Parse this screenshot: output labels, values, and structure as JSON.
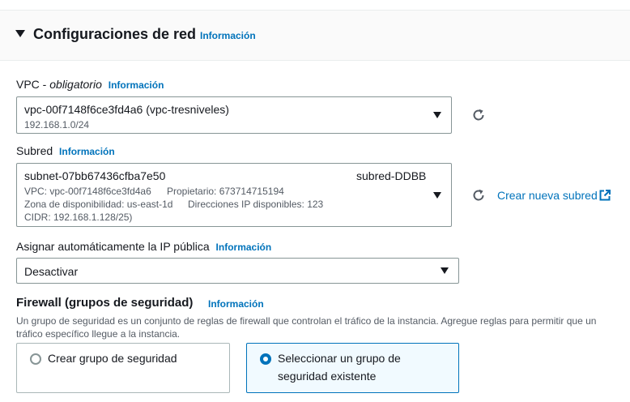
{
  "section": {
    "title": "Configuraciones de red",
    "info": "Información"
  },
  "vpc": {
    "label": "VPC",
    "label_sep": " - ",
    "label_required": "obligatorio",
    "info": "Información",
    "value": "vpc-00f7148f6ce3fd4a6 (vpc-tresniveles)",
    "cidr": "192.168.1.0/24"
  },
  "subnet": {
    "label": "Subred",
    "info": "Información",
    "value": "subnet-07bb67436cfba7e50",
    "name_tag": "subred-DDBB",
    "vpc_line": "VPC: vpc-00f7148f6ce3fd4a6",
    "owner_line": "Propietario: 673714715194",
    "az_line": "Zona de disponibilidad: us-east-1d",
    "ips_line": "Direcciones IP disponibles: 123",
    "cidr_line": "CIDR: 192.168.1.128/25)",
    "create_link": "Crear nueva subred"
  },
  "public_ip": {
    "label": "Asignar automáticamente la IP pública",
    "info": "Información",
    "value": "Desactivar"
  },
  "firewall": {
    "title": "Firewall (grupos de seguridad)",
    "info": "Información",
    "description": "Un grupo de seguridad es un conjunto de reglas de firewall que controlan el tráfico de la instancia. Agregue reglas para permitir que un tráfico específico llegue a la instancia.",
    "options": [
      {
        "label": "Crear grupo de seguridad",
        "selected": false
      },
      {
        "label": "Seleccionar un grupo de seguridad existente",
        "selected": true
      }
    ]
  },
  "colors": {
    "link": "#0073bb",
    "border": "#879596",
    "selected_bg": "#f1faff"
  },
  "icons": [
    "caret-down-icon",
    "refresh-icon",
    "external-link-icon",
    "radio-icon"
  ]
}
